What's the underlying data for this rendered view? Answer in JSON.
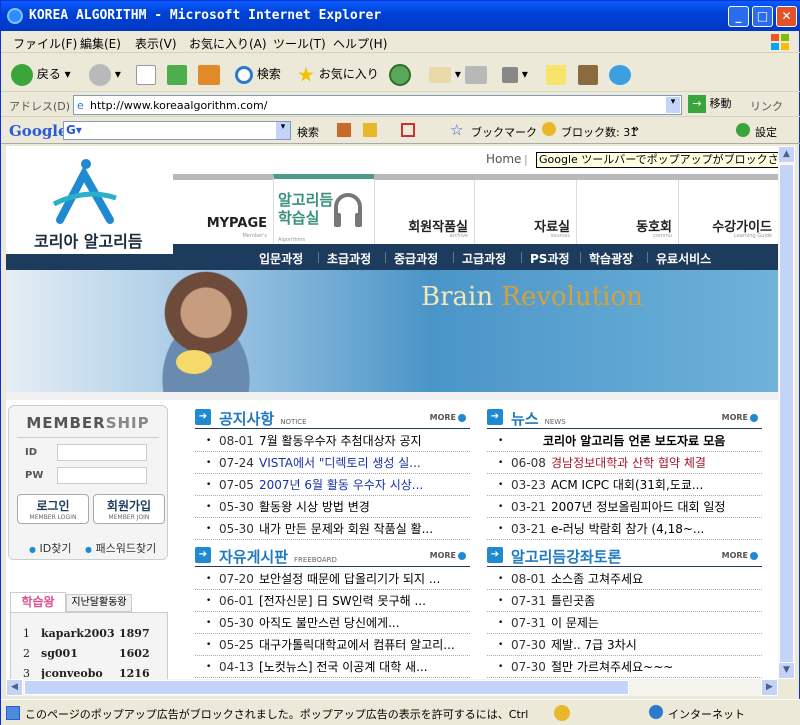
{
  "window": {
    "title": "KOREA ALGORITHM - Microsoft Internet Explorer"
  },
  "menu": [
    "ファイル(F)",
    "編集(E)",
    "表示(V)",
    "お気に入り(A)",
    "ツール(T)",
    "ヘルプ(H)"
  ],
  "toolbar": {
    "back": "戻る",
    "search": "検索",
    "favorites": "お気に入り"
  },
  "address": {
    "label": "アドレス(D)",
    "url": "http://www.koreaalgorithm.com/",
    "go": "移動",
    "links": "リンク"
  },
  "google": {
    "logo": "Google",
    "search": "検索",
    "bookmarks": "ブックマーク",
    "blocked": "ブロック数: 31",
    "settings": "設定",
    "more": "»"
  },
  "page": {
    "logo_text": "코리아 알고리듬",
    "top_link": "Home",
    "tooltip": "Google ツールバーでポップアップがブロックされました。",
    "nav": [
      {
        "label": "MYPAGE",
        "sub": "Member's"
      },
      {
        "label": "알고리듬 학습실",
        "sub": "Algorithms"
      },
      {
        "label": "회원작품실",
        "sub": "archive"
      },
      {
        "label": "자료실",
        "sub": "sources"
      },
      {
        "label": "동호회",
        "sub": "commu"
      },
      {
        "label": "수강가이드",
        "sub": "Learning Guide"
      }
    ],
    "subnav": [
      "입문과정",
      "초급과정",
      "중급과정",
      "고급과정",
      "PS과정",
      "학습광장",
      "유료서비스"
    ],
    "banner": {
      "brain": "Brain ",
      "revolution": "Revolution"
    },
    "member": {
      "title_a": "MEMBER",
      "title_b": "SHIP",
      "id": "ID",
      "pw": "PW",
      "login": "로그인",
      "login_sub": "MEMBER LOGIN",
      "join": "회원가입",
      "join_sub": "MEMBER JOIN",
      "find_id": "ID찾기",
      "find_pw": "패스워드찾기"
    },
    "rank": {
      "tab1": "학습왕",
      "tab2": "지난달활동왕",
      "rows": [
        {
          "n": "1",
          "user": "kapark2003",
          "score": "1897"
        },
        {
          "n": "2",
          "user": "sg001",
          "score": "1602"
        },
        {
          "n": "3",
          "user": "jconveobo",
          "score": "1216"
        }
      ]
    },
    "sections": {
      "notice": {
        "title": "공지사항",
        "sub": "NOTICE",
        "more": "MORE",
        "items": [
          {
            "date": "08-01",
            "text": "7월 활동우수자 추첨대상자 공지",
            "style": ""
          },
          {
            "date": "07-24",
            "text": "VISTA에서 \"디렉토리 생성 실...",
            "style": "blue"
          },
          {
            "date": "07-05",
            "text": "2007년 6월 활동 우수자 시상...",
            "style": "blue"
          },
          {
            "date": "05-30",
            "text": "활동왕 시상 방법 변경",
            "style": ""
          },
          {
            "date": "05-30",
            "text": "내가 만든 문제와 회원 작품실 활...",
            "style": ""
          }
        ]
      },
      "news": {
        "title": "뉴스",
        "sub": "NEWS",
        "more": "MORE",
        "items": [
          {
            "date": "",
            "text": "코리아 알고리듬 언론 보도자료 모음",
            "style": "bold"
          },
          {
            "date": "06-08",
            "text": "경남정보대학과 산학 협약 체결",
            "style": "red"
          },
          {
            "date": "03-23",
            "text": "ACM ICPC 대회(31회,도쿄...",
            "style": ""
          },
          {
            "date": "03-21",
            "text": "2007년 정보올림피아드 대회 일정",
            "style": ""
          },
          {
            "date": "03-21",
            "text": "e-러닝 박람회 참가 (4,18~...",
            "style": ""
          }
        ]
      },
      "free": {
        "title": "자유게시판",
        "sub": "FREEBOARD",
        "more": "MORE",
        "items": [
          {
            "date": "07-20",
            "text": "보안설정 때문에 답올리기가 되지 ...",
            "style": ""
          },
          {
            "date": "06-01",
            "text": "[전자신문] 日 SW인력 못구해 ...",
            "style": ""
          },
          {
            "date": "05-30",
            "text": "아직도 불만스런 당신에게...",
            "style": ""
          },
          {
            "date": "05-25",
            "text": "대구가톨릭대학교에서 컴퓨터 알고리...",
            "style": ""
          },
          {
            "date": "04-13",
            "text": "[노컷뉴스] 전국 이공계 대학 새...",
            "style": ""
          }
        ]
      },
      "forum": {
        "title": "알고리듬강좌토론",
        "sub": "",
        "more": "MORE",
        "items": [
          {
            "date": "08-01",
            "text": "소스좀 고쳐주세요",
            "style": ""
          },
          {
            "date": "07-31",
            "text": "틀린곳좀",
            "style": ""
          },
          {
            "date": "07-31",
            "text": "이 문제는",
            "style": ""
          },
          {
            "date": "07-30",
            "text": "제발.. 7급 3차시",
            "style": ""
          },
          {
            "date": "07-30",
            "text": "절만 가르쳐주세요~~~",
            "style": ""
          }
        ]
      }
    }
  },
  "status": {
    "message": "このページのポップアップ広告がブロックされました。ポップアップ広告の表示を許可するには、Ctrl キーを押し",
    "zone": "インターネット"
  }
}
